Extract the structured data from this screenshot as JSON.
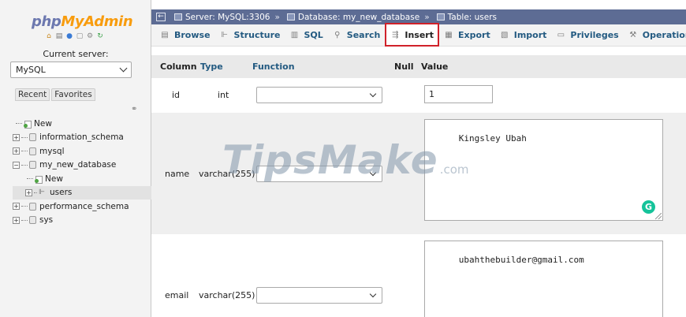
{
  "app": {
    "logo_part1": "php",
    "logo_part2": "MyAdmin",
    "current_server_label": "Current server:",
    "server_selected": "MySQL"
  },
  "left_tabs": [
    "Recent",
    "Favorites"
  ],
  "tree": [
    {
      "label": "New",
      "kind": "new",
      "indent": 0
    },
    {
      "label": "information_schema",
      "kind": "db",
      "indent": 0
    },
    {
      "label": "mysql",
      "kind": "db",
      "indent": 0
    },
    {
      "label": "my_new_database",
      "kind": "db-open",
      "indent": 0
    },
    {
      "label": "New",
      "kind": "new",
      "indent": 1
    },
    {
      "label": "users",
      "kind": "table",
      "indent": 1
    },
    {
      "label": "performance_schema",
      "kind": "db",
      "indent": 0
    },
    {
      "label": "sys",
      "kind": "db",
      "indent": 0
    }
  ],
  "breadcrumb": {
    "server": "Server: MySQL:3306",
    "database": "Database: my_new_database",
    "table": "Table: users",
    "separator": "»"
  },
  "tabs": [
    {
      "label": "Browse",
      "icon": "browse-icon",
      "glyph": "▤",
      "active": false
    },
    {
      "label": "Structure",
      "icon": "structure-icon",
      "glyph": "⊩",
      "active": false
    },
    {
      "label": "SQL",
      "icon": "sql-icon",
      "glyph": "▥",
      "active": false
    },
    {
      "label": "Search",
      "icon": "search-icon",
      "glyph": "⚲",
      "active": false
    },
    {
      "label": "Insert",
      "icon": "insert-icon",
      "glyph": "⇶",
      "active": true
    },
    {
      "label": "Export",
      "icon": "export-icon",
      "glyph": "▦",
      "active": false
    },
    {
      "label": "Import",
      "icon": "import-icon",
      "glyph": "▧",
      "active": false
    },
    {
      "label": "Privileges",
      "icon": "privileges-icon",
      "glyph": "▭",
      "active": false
    },
    {
      "label": "Operations",
      "icon": "operations-icon",
      "glyph": "⚒",
      "active": false
    }
  ],
  "insert_table": {
    "headers": {
      "column": "Column",
      "type": "Type",
      "function": "Function",
      "null": "Null",
      "value": "Value"
    },
    "rows": [
      {
        "column": "id",
        "type": "int",
        "function": "",
        "value": "1",
        "input": "text"
      },
      {
        "column": "name",
        "type": "varchar(255)",
        "function": "",
        "value": "Kingsley Ubah",
        "input": "textarea"
      },
      {
        "column": "email",
        "type": "varchar(255)",
        "function": "",
        "value": "ubahthebuilder@gmail.com",
        "input": "textarea"
      }
    ]
  },
  "watermark": {
    "main": "TipsMake",
    "sub": ".com"
  },
  "colors": {
    "breadcrumb_bg": "#5d6c94",
    "tab_link": "#235a81",
    "active_tab_border": "#d0212a",
    "logo_php": "#6c78af",
    "logo_admin": "#f89c0e"
  }
}
